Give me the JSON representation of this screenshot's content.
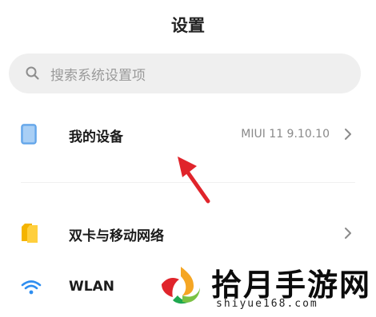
{
  "header": {
    "title": "设置"
  },
  "search": {
    "placeholder": "搜索系统设置项"
  },
  "items": [
    {
      "label": "我的设备",
      "value": "MIUI 11 9.10.10",
      "icon": "device-icon"
    },
    {
      "label": "双卡与移动网络",
      "value": "",
      "icon": "sim-card-icon"
    },
    {
      "label": "WLAN",
      "value": "",
      "icon": "wifi-icon"
    }
  ],
  "watermark": {
    "brand": "拾月手游网",
    "url": "shiyue168.com"
  },
  "colors": {
    "accent_blue": "#5aa0e8",
    "sim_yellow": "#f4b400",
    "wifi_blue": "#2f8ef0",
    "arrow_red": "#e0242b"
  }
}
